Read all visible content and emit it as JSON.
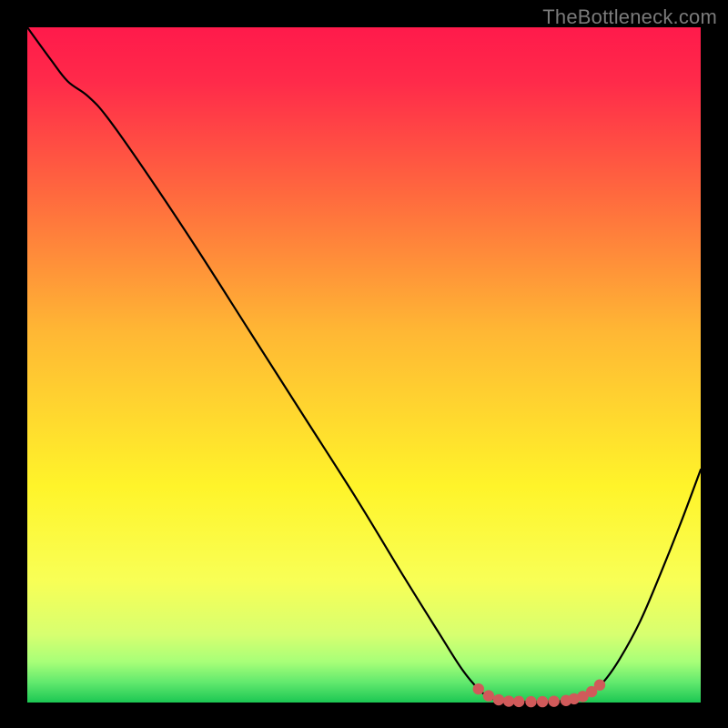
{
  "watermark": "TheBottleneck.com",
  "chart_data": {
    "type": "line",
    "title": "",
    "xlabel": "",
    "ylabel": "",
    "xlim": [
      0,
      100
    ],
    "ylim": [
      0,
      100
    ],
    "background_gradient": {
      "stops": [
        {
          "offset": 0.0,
          "color": "#ff1a4b"
        },
        {
          "offset": 0.08,
          "color": "#ff2a4a"
        },
        {
          "offset": 0.25,
          "color": "#ff6a3e"
        },
        {
          "offset": 0.45,
          "color": "#ffb734"
        },
        {
          "offset": 0.68,
          "color": "#fff42a"
        },
        {
          "offset": 0.82,
          "color": "#f8ff56"
        },
        {
          "offset": 0.9,
          "color": "#d7ff70"
        },
        {
          "offset": 0.94,
          "color": "#a7ff78"
        },
        {
          "offset": 0.97,
          "color": "#62e96e"
        },
        {
          "offset": 1.0,
          "color": "#1cc753"
        }
      ]
    },
    "curve": {
      "color": "#000000",
      "width": 2.2,
      "points": [
        {
          "x": 0.0,
          "y": 100.0
        },
        {
          "x": 3.5,
          "y": 95.2
        },
        {
          "x": 6.0,
          "y": 92.0
        },
        {
          "x": 9.0,
          "y": 89.8
        },
        {
          "x": 12.0,
          "y": 86.5
        },
        {
          "x": 18.0,
          "y": 78.0
        },
        {
          "x": 25.0,
          "y": 67.5
        },
        {
          "x": 33.0,
          "y": 55.0
        },
        {
          "x": 41.0,
          "y": 42.5
        },
        {
          "x": 49.0,
          "y": 30.0
        },
        {
          "x": 56.0,
          "y": 18.5
        },
        {
          "x": 61.0,
          "y": 10.5
        },
        {
          "x": 64.5,
          "y": 5.0
        },
        {
          "x": 67.0,
          "y": 2.0
        },
        {
          "x": 69.0,
          "y": 0.6
        },
        {
          "x": 72.0,
          "y": 0.15
        },
        {
          "x": 76.0,
          "y": 0.12
        },
        {
          "x": 80.0,
          "y": 0.25
        },
        {
          "x": 83.0,
          "y": 1.0
        },
        {
          "x": 85.5,
          "y": 3.0
        },
        {
          "x": 88.0,
          "y": 6.5
        },
        {
          "x": 91.0,
          "y": 12.0
        },
        {
          "x": 94.0,
          "y": 19.0
        },
        {
          "x": 97.0,
          "y": 26.5
        },
        {
          "x": 100.0,
          "y": 34.5
        }
      ]
    },
    "marker_series": {
      "color": "#d05a5a",
      "radius": 6.2,
      "points": [
        {
          "x": 67.0,
          "y": 2.0
        },
        {
          "x": 68.5,
          "y": 1.0
        },
        {
          "x": 70.0,
          "y": 0.4
        },
        {
          "x": 71.5,
          "y": 0.2
        },
        {
          "x": 73.0,
          "y": 0.15
        },
        {
          "x": 74.8,
          "y": 0.12
        },
        {
          "x": 76.5,
          "y": 0.12
        },
        {
          "x": 78.2,
          "y": 0.18
        },
        {
          "x": 80.0,
          "y": 0.3
        },
        {
          "x": 81.2,
          "y": 0.55
        },
        {
          "x": 82.5,
          "y": 0.9
        },
        {
          "x": 83.8,
          "y": 1.6
        },
        {
          "x": 85.0,
          "y": 2.6
        }
      ]
    }
  }
}
